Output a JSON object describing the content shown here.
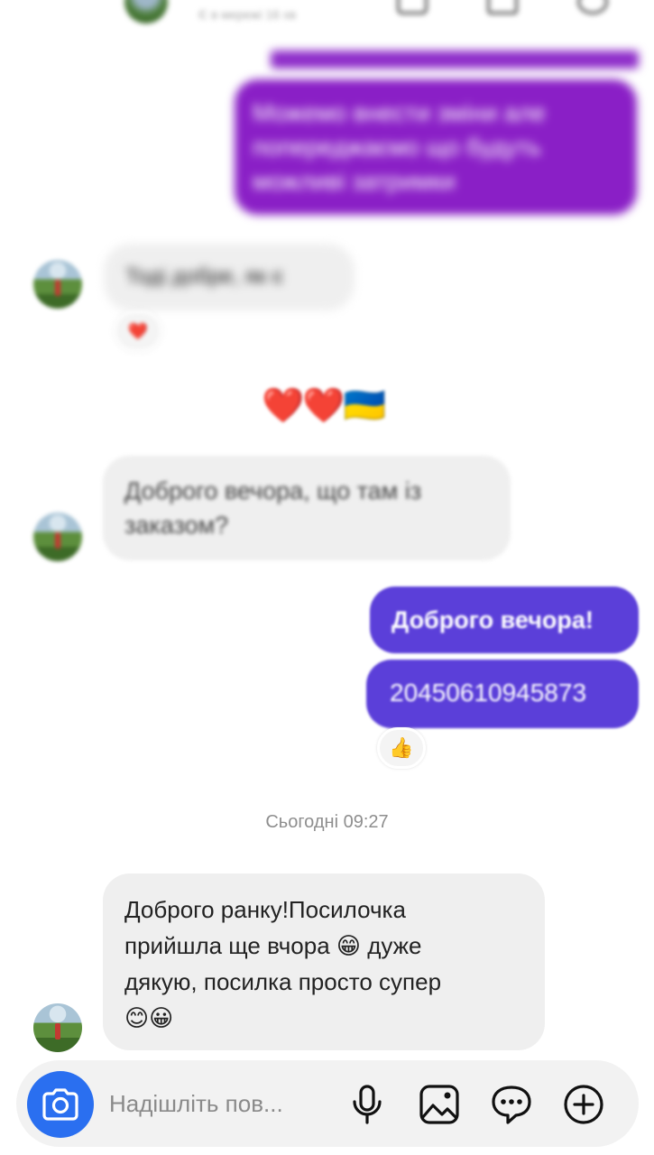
{
  "header": {
    "subtitle": "Є в мережі 16 хв"
  },
  "messages": [
    {
      "side": "right",
      "text_lines": [
        "Можемо внести зміни але",
        "попереджаємо що будуть",
        "можливі затримки"
      ]
    },
    {
      "side": "left",
      "text": "Тоді добре, як є",
      "reaction": "❤️"
    },
    {
      "side": "left",
      "text": "❤️❤️🇺🇦"
    },
    {
      "side": "left",
      "text_lines": [
        "Доброго вечора, що там із",
        "заказом?"
      ]
    },
    {
      "side": "right",
      "text": "Доброго вечора!"
    },
    {
      "side": "right",
      "text": "20450610945873",
      "reaction": "👍"
    },
    {
      "side": "left",
      "text_lines": [
        "Доброго ранку!Посилочка",
        "прийшла ще вчора 😁 дуже",
        "дякую, посилка просто супер",
        "😊😀"
      ]
    }
  ],
  "timestamp": "Сьогодні 09:27",
  "composer": {
    "placeholder": "Надішліть пов...",
    "icons": [
      "camera-icon",
      "microphone-icon",
      "gallery-icon",
      "sticker-icon",
      "plus-icon"
    ]
  },
  "colors": {
    "purple_bubble": "#8a1fc6",
    "indigo_bubble": "#5b3fd9",
    "grey_bubble": "#efefef",
    "camera_button": "#2a6ff0"
  }
}
